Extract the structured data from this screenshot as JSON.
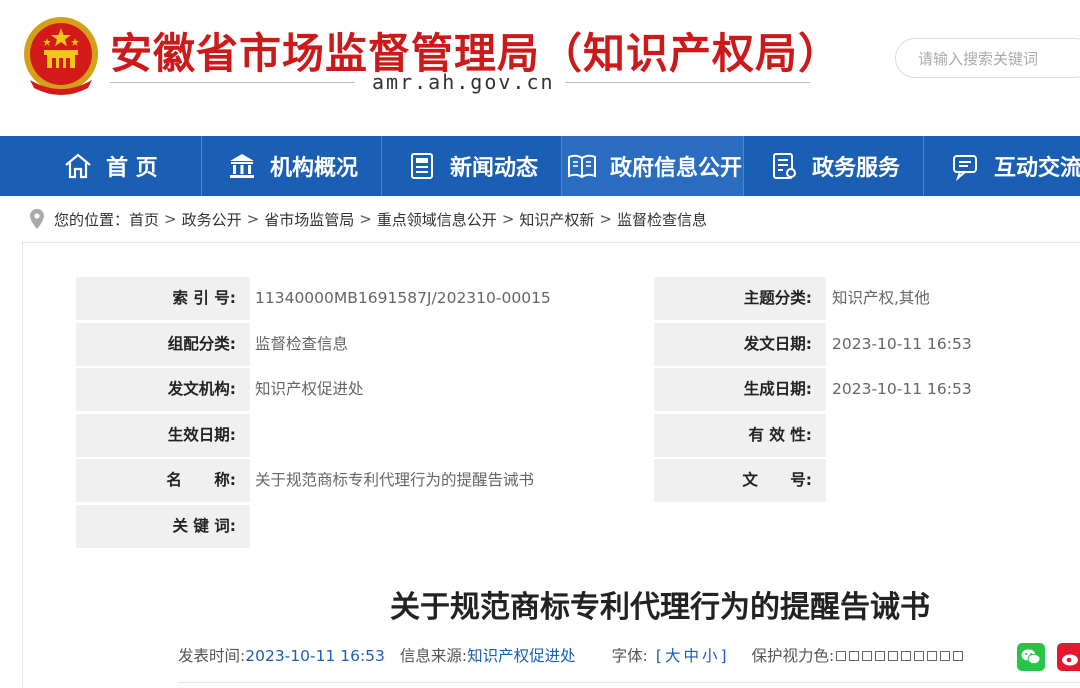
{
  "header": {
    "site_title": "安徽省市场监督管理局（知识产权局）",
    "site_domain": "amr.ah.gov.cn",
    "search_placeholder": "请输入搜索关键词"
  },
  "nav": {
    "items": [
      {
        "label": "首 页",
        "icon": "home-icon"
      },
      {
        "label": "机构概况",
        "icon": "institution-icon"
      },
      {
        "label": "新闻动态",
        "icon": "news-icon"
      },
      {
        "label": "政府信息公开",
        "icon": "open-book-icon"
      },
      {
        "label": "政务服务",
        "icon": "service-document-icon"
      },
      {
        "label": "互动交流",
        "icon": "chat-icon"
      }
    ],
    "active_index": 3
  },
  "breadcrumb": {
    "prefix": "您的位置：",
    "items": [
      "首页",
      "政务公开",
      "省市场监管局",
      "重点领域信息公开",
      "知识产权新",
      "监督检查信息"
    ],
    "separator": ">"
  },
  "info": {
    "index_no_label": "索 引 号:",
    "index_no": "11340000MB1691587J/202310-00015",
    "topic_label": "主题分类:",
    "topic": "知识产权,其他",
    "category_label": "组配分类:",
    "category": "监督检查信息",
    "pub_date_label": "发文日期:",
    "pub_date": "2023-10-11 16:53",
    "agency_label": "发文机构:",
    "agency": "知识产权促进处",
    "gen_date_label": "生成日期:",
    "gen_date": "2023-10-11 16:53",
    "effective_date_label": "生效日期:",
    "effective_date": "",
    "validity_label": "有 效 性:",
    "validity": "",
    "name_label": "名      称:",
    "name": "关于规范商标专利代理行为的提醒告诫书",
    "doc_no_label": "文      号:",
    "doc_no": "",
    "keywords_label": "关 键 词:",
    "keywords": ""
  },
  "article": {
    "title": "关于规范商标专利代理行为的提醒告诫书",
    "publish_time_label": "发表时间:",
    "publish_time": "2023-10-11 16:53",
    "source_label": "信息来源:",
    "source": "知识产权促进处",
    "font_label": "字体:",
    "font_controls": "[大中小]",
    "eye_color_label": "保护视力色:"
  },
  "colors": {
    "brand_red": "#cc1a1a",
    "nav_blue": "#1a5fb4",
    "link_blue": "#1a5fb4",
    "wechat_green": "#28c445",
    "weibo_red": "#e6162d"
  }
}
